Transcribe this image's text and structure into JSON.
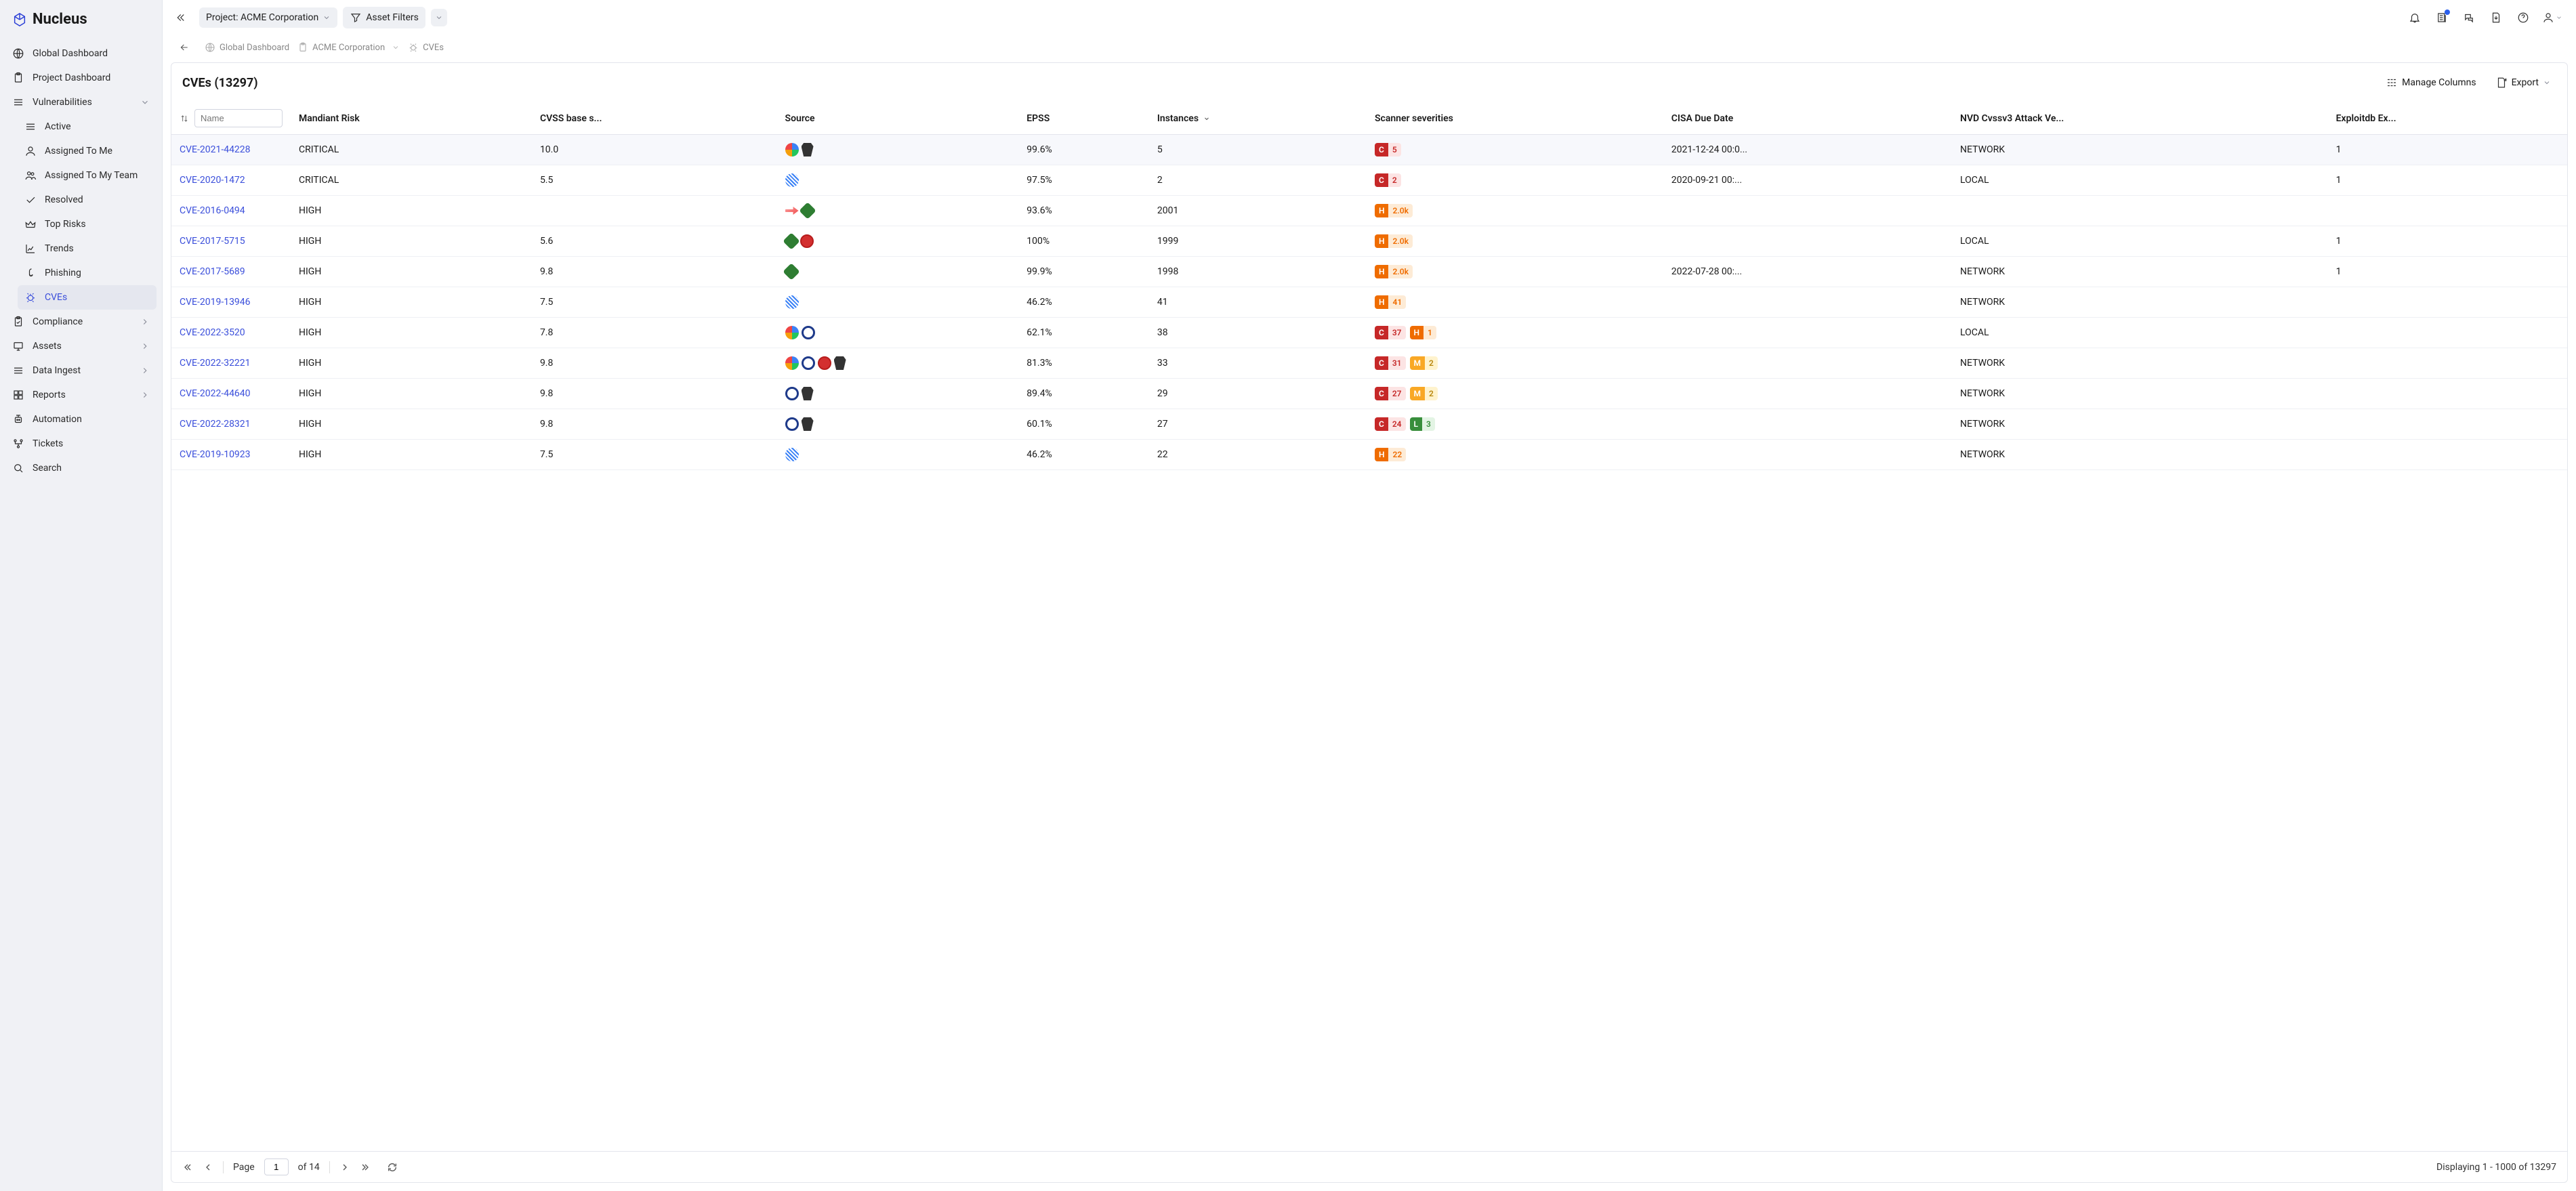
{
  "app_name": "Nucleus",
  "topbar": {
    "project_label": "Project: ACME Corporation",
    "filters_label": "Asset Filters"
  },
  "breadcrumb": {
    "items": [
      "Global Dashboard",
      "ACME Corporation",
      "CVEs"
    ]
  },
  "sidebar": {
    "items": [
      {
        "label": "Global Dashboard",
        "icon": "globe"
      },
      {
        "label": "Project Dashboard",
        "icon": "clipboard"
      },
      {
        "label": "Vulnerabilities",
        "icon": "list-lines",
        "expandable": true,
        "expanded": true,
        "children": [
          {
            "label": "Active",
            "icon": "list-lines"
          },
          {
            "label": "Assigned To Me",
            "icon": "user"
          },
          {
            "label": "Assigned To My Team",
            "icon": "users"
          },
          {
            "label": "Resolved",
            "icon": "check"
          },
          {
            "label": "Top Risks",
            "icon": "crown"
          },
          {
            "label": "Trends",
            "icon": "chart-line"
          },
          {
            "label": "Phishing",
            "icon": "hook"
          },
          {
            "label": "CVEs",
            "icon": "bug",
            "active": true
          }
        ]
      },
      {
        "label": "Compliance",
        "icon": "clipboard-check",
        "expandable": true
      },
      {
        "label": "Assets",
        "icon": "monitor",
        "expandable": true
      },
      {
        "label": "Data Ingest",
        "icon": "list-lines",
        "expandable": true
      },
      {
        "label": "Reports",
        "icon": "grid",
        "expandable": true
      },
      {
        "label": "Automation",
        "icon": "robot"
      },
      {
        "label": "Tickets",
        "icon": "flowchart"
      },
      {
        "label": "Search",
        "icon": "search"
      }
    ]
  },
  "page": {
    "title": "CVEs (13297)",
    "manage_columns": "Manage Columns",
    "export": "Export"
  },
  "table": {
    "name_placeholder": "Name",
    "columns": [
      "Mandiant Risk",
      "CVSS base s...",
      "Source",
      "EPSS",
      "Instances",
      "Scanner severities",
      "CISA Due Date",
      "NVD Cvssv3 Attack Ve...",
      "Exploitdb Ex..."
    ],
    "rows": [
      {
        "cve": "CVE-2021-44228",
        "risk": "CRITICAL",
        "cvss": "10.0",
        "sources": [
          "tenable",
          "crowd"
        ],
        "epss": "99.6%",
        "inst": "5",
        "sev": [
          {
            "l": "C",
            "c": "5"
          }
        ],
        "cisa": "2021-12-24 00:0...",
        "vec": "NETWORK",
        "exp": "1"
      },
      {
        "cve": "CVE-2020-1472",
        "risk": "CRITICAL",
        "cvss": "5.5",
        "sources": [
          "claroty"
        ],
        "epss": "97.5%",
        "inst": "2",
        "sev": [
          {
            "l": "C",
            "c": "2"
          }
        ],
        "cisa": "2020-09-21 00:...",
        "vec": "LOCAL",
        "exp": "1"
      },
      {
        "cve": "CVE-2016-0494",
        "risk": "HIGH",
        "cvss": "",
        "sources": [
          "arrow",
          "nessus"
        ],
        "epss": "93.6%",
        "inst": "2001",
        "sev": [
          {
            "l": "H",
            "c": "2.0k"
          }
        ],
        "cisa": "",
        "vec": "",
        "exp": ""
      },
      {
        "cve": "CVE-2017-5715",
        "risk": "HIGH",
        "cvss": "5.6",
        "sources": [
          "nessus",
          "qualys"
        ],
        "epss": "100%",
        "inst": "1999",
        "sev": [
          {
            "l": "H",
            "c": "2.0k"
          }
        ],
        "cisa": "",
        "vec": "LOCAL",
        "exp": "1"
      },
      {
        "cve": "CVE-2017-5689",
        "risk": "HIGH",
        "cvss": "9.8",
        "sources": [
          "nessus"
        ],
        "epss": "99.9%",
        "inst": "1998",
        "sev": [
          {
            "l": "H",
            "c": "2.0k"
          }
        ],
        "cisa": "2022-07-28 00:...",
        "vec": "NETWORK",
        "exp": "1"
      },
      {
        "cve": "CVE-2019-13946",
        "risk": "HIGH",
        "cvss": "7.5",
        "sources": [
          "claroty"
        ],
        "epss": "46.2%",
        "inst": "41",
        "sev": [
          {
            "l": "H",
            "c": "41"
          }
        ],
        "cisa": "",
        "vec": "NETWORK",
        "exp": ""
      },
      {
        "cve": "CVE-2022-3520",
        "risk": "HIGH",
        "cvss": "7.8",
        "sources": [
          "tenable",
          "rapid"
        ],
        "epss": "62.1%",
        "inst": "38",
        "sev": [
          {
            "l": "C",
            "c": "37"
          },
          {
            "l": "H",
            "c": "1"
          }
        ],
        "cisa": "",
        "vec": "LOCAL",
        "exp": ""
      },
      {
        "cve": "CVE-2022-32221",
        "risk": "HIGH",
        "cvss": "9.8",
        "sources": [
          "tenable",
          "rapid",
          "qualys",
          "crowd"
        ],
        "epss": "81.3%",
        "inst": "33",
        "sev": [
          {
            "l": "C",
            "c": "31"
          },
          {
            "l": "M",
            "c": "2"
          }
        ],
        "cisa": "",
        "vec": "NETWORK",
        "exp": ""
      },
      {
        "cve": "CVE-2022-44640",
        "risk": "HIGH",
        "cvss": "9.8",
        "sources": [
          "rapid",
          "crowd"
        ],
        "epss": "89.4%",
        "inst": "29",
        "sev": [
          {
            "l": "C",
            "c": "27"
          },
          {
            "l": "M",
            "c": "2"
          }
        ],
        "cisa": "",
        "vec": "NETWORK",
        "exp": ""
      },
      {
        "cve": "CVE-2022-28321",
        "risk": "HIGH",
        "cvss": "9.8",
        "sources": [
          "rapid",
          "crowd"
        ],
        "epss": "60.1%",
        "inst": "27",
        "sev": [
          {
            "l": "C",
            "c": "24"
          },
          {
            "l": "L",
            "c": "3"
          }
        ],
        "cisa": "",
        "vec": "NETWORK",
        "exp": ""
      },
      {
        "cve": "CVE-2019-10923",
        "risk": "HIGH",
        "cvss": "7.5",
        "sources": [
          "claroty"
        ],
        "epss": "46.2%",
        "inst": "22",
        "sev": [
          {
            "l": "H",
            "c": "22"
          }
        ],
        "cisa": "",
        "vec": "NETWORK",
        "exp": ""
      }
    ]
  },
  "paginator": {
    "page_label": "Page",
    "page_value": "1",
    "total_pages": "of 14",
    "display_text": "Displaying 1 - 1000 of 13297"
  }
}
